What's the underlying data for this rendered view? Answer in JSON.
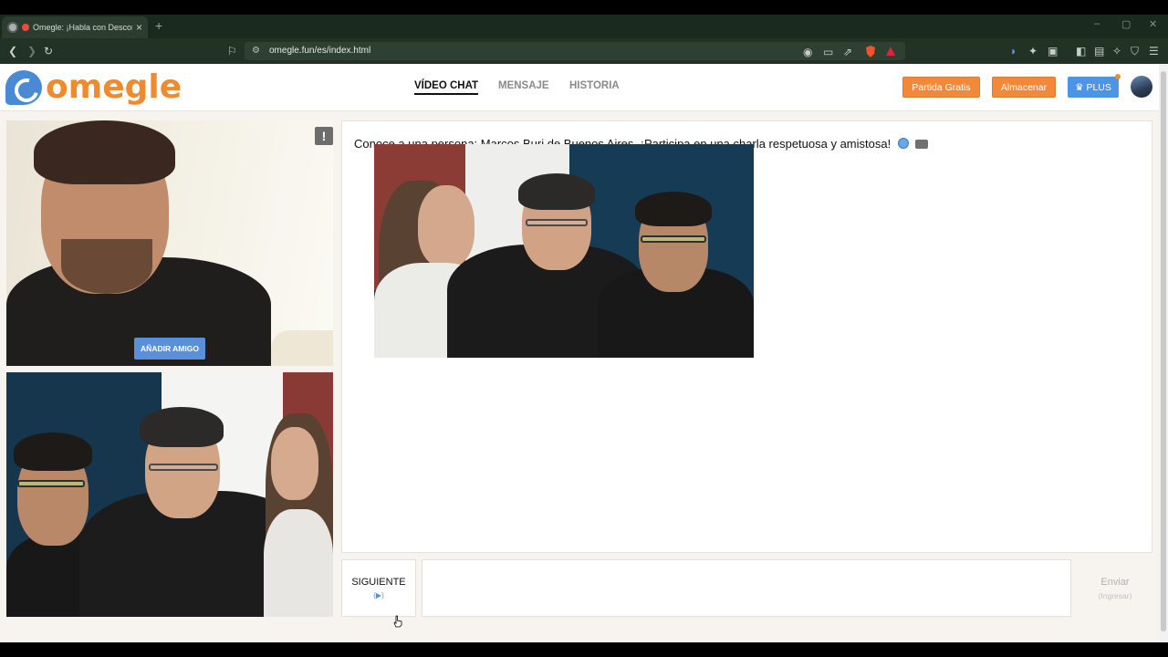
{
  "browser": {
    "tab_title": "Omegle: ¡Habla con Desconocidos!",
    "tab_close": "×",
    "new_tab": "+",
    "url": "omegle.fun/es/index.html",
    "window_controls": [
      "–",
      "▢",
      "✕"
    ]
  },
  "header": {
    "logo_text": "omegle",
    "nav": [
      {
        "label": "VÍDEO CHAT",
        "active": true
      },
      {
        "label": "MENSAJE",
        "active": false
      },
      {
        "label": "HISTORIA",
        "active": false
      }
    ],
    "free_match_label": "Partida Gratis",
    "store_label": "Almacenar",
    "plus_label": "♛ PLUS"
  },
  "video": {
    "report_label": "!",
    "add_friend_label": "AÑADIR AMIGO"
  },
  "chat": {
    "message": "Conoce a una persona: Marcos Buri de Buenos Aires. ¡Participa en una charla respetuosa y amistosa!"
  },
  "controls": {
    "next_label": "SIGUIENTE",
    "next_key": "(▶)",
    "send_label": "Enviar",
    "send_key": "(Ingresar)",
    "message_placeholder": ""
  },
  "colors": {
    "brand_orange": "#f08a2c",
    "brand_blue": "#4a8ad4",
    "page_bg": "#f7f4ef"
  }
}
